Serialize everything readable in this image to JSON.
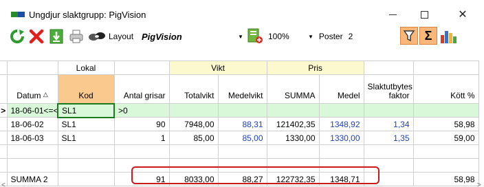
{
  "window": {
    "title": "Ungdjur slaktgrupp: PigVision"
  },
  "toolbar": {
    "layout_label": "Layout",
    "layout_value": "PigVision",
    "zoom_value": "100%",
    "poster_label": "Poster",
    "poster_value": "2"
  },
  "icons": [
    "refresh-icon",
    "delete-icon",
    "download-icon",
    "print-icon",
    "link-icon",
    "export-icon",
    "filter-icon",
    "sum-icon",
    "chart-icon"
  ],
  "grid": {
    "group_headers": {
      "lokal": "Lokal",
      "vikt": "Vikt",
      "pris": "Pris"
    },
    "columns": {
      "datum": "Datum",
      "kod": "Kod",
      "antal": "Antal grisar",
      "totalvikt": "Totalvikt",
      "medelvikt": "Medelvikt",
      "summa": "SUMMA",
      "medel": "Medel",
      "faktor_1": "Slaktutbytes",
      "faktor_2": "faktor",
      "kott": "Kött %"
    },
    "filter": {
      "indicator": ">",
      "datum": "18-06-01<=<",
      "kod": "SL1",
      "antal": ">0"
    },
    "rows": [
      {
        "datum": "18-06-02",
        "kod": "SL1",
        "antal": "90",
        "totalvikt": "7948,00",
        "medelvikt": "88,31",
        "summa": "121402,35",
        "medel": "1348,92",
        "faktor": "1,34",
        "kott": "58,98"
      },
      {
        "datum": "18-06-03",
        "kod": "SL1",
        "antal": "1",
        "totalvikt": "85,00",
        "medelvikt": "85,00",
        "summa": "1330,00",
        "medel": "1330,00",
        "faktor": "1,35",
        "kott": "59,00"
      }
    ],
    "summary": {
      "label": "SUMMA 2",
      "antal": "91",
      "totalvikt": "8033,00",
      "medelvikt": "88,27",
      "summa": "122732,35",
      "medel": "1348,71",
      "kott": "58,98"
    }
  },
  "colors": {
    "filter_row": "#d9f7d9",
    "group_yellow": "#fdf9cf",
    "kod_header": "#f9c98e",
    "highlight_box": "#d0171b",
    "value_blue": "#1f3fbf"
  }
}
